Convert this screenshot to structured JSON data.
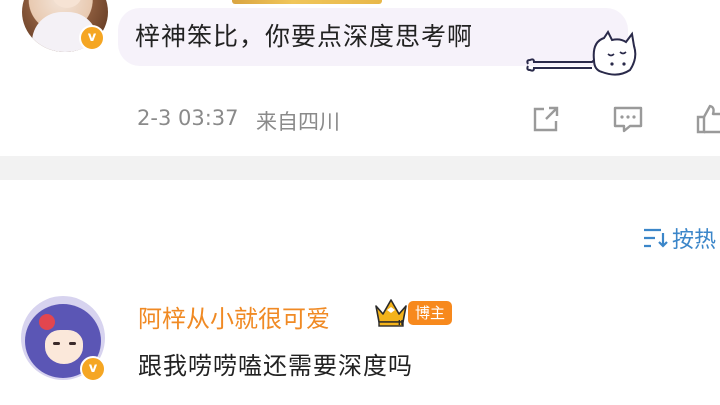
{
  "comment_top": {
    "text": "梓神笨比，你要点深度思考啊",
    "time": "2-3 03:37",
    "location": "来自四川",
    "verified_badge": "v",
    "icons": [
      "share-icon",
      "comment-icon",
      "like-icon"
    ]
  },
  "sort": {
    "label": "按热"
  },
  "comment_reply": {
    "username": "阿梓从小就很可爱",
    "tag": "博主",
    "crown_level": "II",
    "text": "跟我唠唠嗑还需要深度吗",
    "verified_badge": "v"
  },
  "colors": {
    "username": "#f08a24",
    "tag_bg": "#f7891d",
    "sort_link": "#3b86c9",
    "bubble_bg": "#f6f2fa",
    "meta_text": "#8a8a8a"
  }
}
